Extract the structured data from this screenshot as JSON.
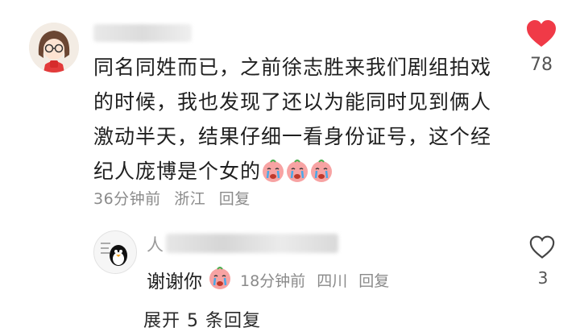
{
  "comment": {
    "avatar_icon": "cartoon-girl-avatar-icon",
    "lines": [
      "同名同姓而已，之前徐志胜来我们剧组拍戏",
      "的时候，我也发现了还以为能同时见到俩人",
      "激动半天，结果仔细一看身份证号，这个经",
      "纪人庞博是个女的"
    ],
    "emojis": [
      "crying-emoji-icon",
      "crying-emoji-icon",
      "crying-emoji-icon"
    ],
    "time": "36分钟前",
    "location": "浙江",
    "reply_label": "回复",
    "like_count": "78",
    "like_color": "#f03a47"
  },
  "sub_reply": {
    "avatar_icon": "penguin-avatar-icon",
    "name_prefix": "人",
    "text": "谢谢你",
    "emoji": "crying-emoji-icon",
    "time": "18分钟前",
    "location": "四川",
    "reply_label": "回复",
    "like_count": "3"
  },
  "expand_label": "展开 5 条回复"
}
